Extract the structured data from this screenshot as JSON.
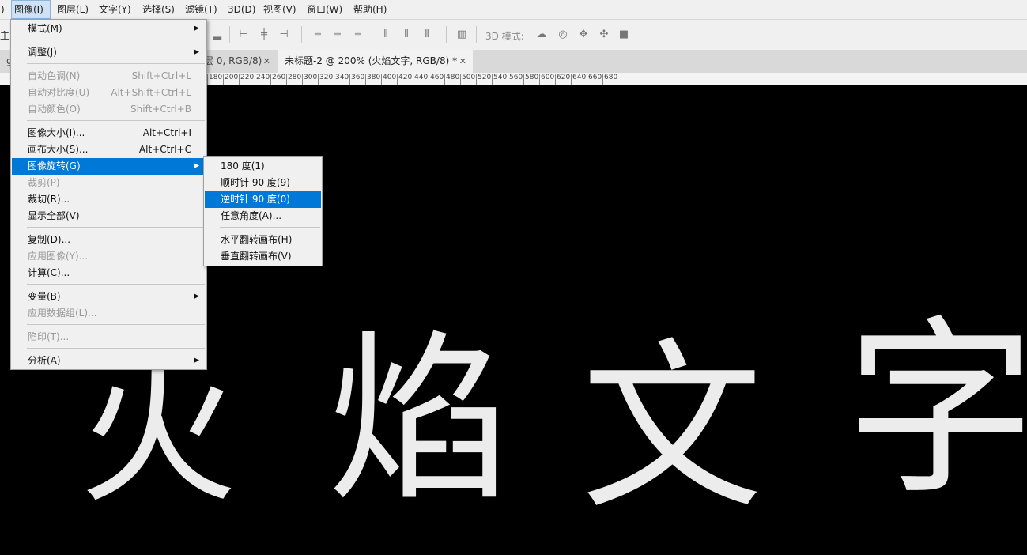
{
  "menubar": {
    "items": [
      {
        "label": ")"
      },
      {
        "label": "图像(I)"
      },
      {
        "label": "图层(L)"
      },
      {
        "label": "文字(Y)"
      },
      {
        "label": "选择(S)"
      },
      {
        "label": "滤镜(T)"
      },
      {
        "label": "3D(D)"
      },
      {
        "label": "视图(V)"
      },
      {
        "label": "窗口(W)"
      },
      {
        "label": "帮助(H)"
      }
    ]
  },
  "optionsbar": {
    "left_fragment": "主:",
    "mode3d_label": "3D 模式:"
  },
  "tabs": [
    {
      "label": "gti"
    },
    {
      "label": "层 0, RGB/8)"
    },
    {
      "label": "未标题-2 @ 200% (火焰文字, RGB/8) *"
    }
  ],
  "ruler": {
    "labels": [
      "180",
      "200",
      "220",
      "240",
      "260",
      "280",
      "300",
      "320",
      "340",
      "360",
      "380",
      "400",
      "420",
      "440",
      "460",
      "480",
      "500",
      "520",
      "540",
      "560",
      "580",
      "600",
      "620",
      "640",
      "660",
      "680"
    ]
  },
  "canvas": {
    "characters": [
      "火",
      "焰",
      "文",
      "字"
    ],
    "text_color": "#ececec"
  },
  "image_menu": {
    "items": [
      {
        "label": "模式(M)",
        "shortcut": "",
        "submenu": true,
        "disabled": false
      },
      {
        "label": "调整(J)",
        "shortcut": "",
        "submenu": true,
        "disabled": false
      },
      {
        "label": "自动色调(N)",
        "shortcut": "Shift+Ctrl+L",
        "submenu": false,
        "disabled": true
      },
      {
        "label": "自动对比度(U)",
        "shortcut": "Alt+Shift+Ctrl+L",
        "submenu": false,
        "disabled": true
      },
      {
        "label": "自动颜色(O)",
        "shortcut": "Shift+Ctrl+B",
        "submenu": false,
        "disabled": true
      },
      {
        "label": "图像大小(I)...",
        "shortcut": "Alt+Ctrl+I",
        "submenu": false,
        "disabled": false
      },
      {
        "label": "画布大小(S)...",
        "shortcut": "Alt+Ctrl+C",
        "submenu": false,
        "disabled": false
      },
      {
        "label": "图像旋转(G)",
        "shortcut": "",
        "submenu": true,
        "disabled": false
      },
      {
        "label": "裁剪(P)",
        "shortcut": "",
        "submenu": false,
        "disabled": true
      },
      {
        "label": "裁切(R)...",
        "shortcut": "",
        "submenu": false,
        "disabled": false
      },
      {
        "label": "显示全部(V)",
        "shortcut": "",
        "submenu": false,
        "disabled": false
      },
      {
        "label": "复制(D)...",
        "shortcut": "",
        "submenu": false,
        "disabled": false
      },
      {
        "label": "应用图像(Y)...",
        "shortcut": "",
        "submenu": false,
        "disabled": true
      },
      {
        "label": "计算(C)...",
        "shortcut": "",
        "submenu": false,
        "disabled": false
      },
      {
        "label": "变量(B)",
        "shortcut": "",
        "submenu": true,
        "disabled": false
      },
      {
        "label": "应用数据组(L)...",
        "shortcut": "",
        "submenu": false,
        "disabled": true
      },
      {
        "label": "陷印(T)...",
        "shortcut": "",
        "submenu": false,
        "disabled": true
      },
      {
        "label": "分析(A)",
        "shortcut": "",
        "submenu": true,
        "disabled": false
      }
    ]
  },
  "rotate_submenu": {
    "items": [
      {
        "label": "180 度(1)"
      },
      {
        "label": "顺时针 90 度(9)"
      },
      {
        "label": "逆时针 90 度(0)"
      },
      {
        "label": "任意角度(A)..."
      },
      {
        "label": "水平翻转画布(H)"
      },
      {
        "label": "垂直翻转画布(V)"
      }
    ]
  },
  "colors": {
    "highlight": "#0078d7",
    "menu_bg": "#f0f0f0",
    "canvas_bg": "#000000"
  }
}
